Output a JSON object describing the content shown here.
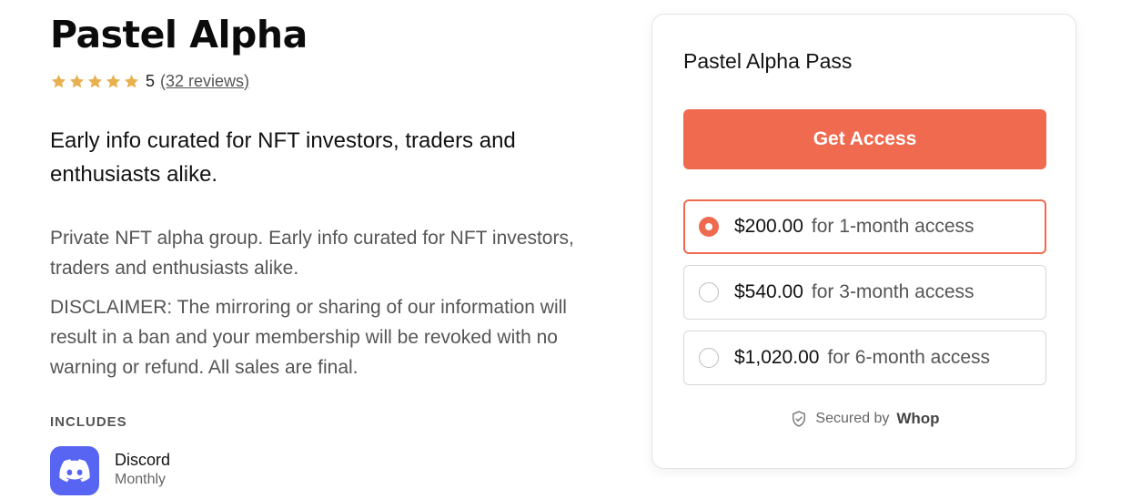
{
  "product": {
    "title": "Pastel Alpha",
    "rating_value": "5",
    "reviews_label": "(32 reviews)",
    "star_count": 5,
    "tagline": "Early info curated for NFT investors, traders and enthusiasts alike.",
    "description": "Private NFT alpha group. Early info curated for NFT investors, traders and enthusiasts alike.",
    "disclaimer": "DISCLAIMER: The mirroring or sharing of our information will result in a ban and your membership will be revoked with no warning or refund. All sales are final."
  },
  "includes": {
    "label": "INCLUDES",
    "items": [
      {
        "name": "Discord",
        "period": "Monthly",
        "icon": "discord-logo-icon"
      }
    ]
  },
  "checkout": {
    "title": "Pastel Alpha Pass",
    "cta_label": "Get Access",
    "plans": [
      {
        "price": "$200.00",
        "term": "for 1-month access",
        "selected": true
      },
      {
        "price": "$540.00",
        "term": "for 3-month access",
        "selected": false
      },
      {
        "price": "$1,020.00",
        "term": "for 6-month access",
        "selected": false
      }
    ],
    "secured_text": "Secured by",
    "secured_brand": "Whop"
  },
  "colors": {
    "accent": "#ef6a4f",
    "star": "#e8b04f",
    "discord": "#5865F2"
  }
}
